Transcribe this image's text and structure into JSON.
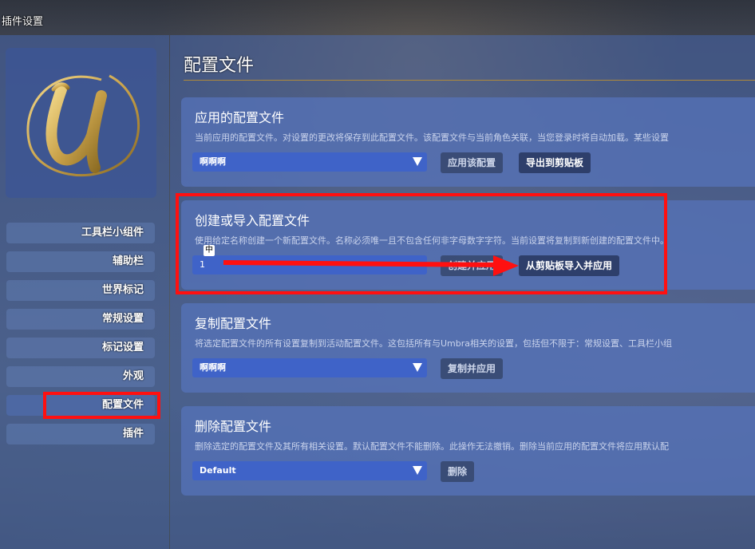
{
  "window": {
    "title": "插件设置"
  },
  "sidebar": {
    "items": [
      {
        "label": "工具栏小组件"
      },
      {
        "label": "辅助栏"
      },
      {
        "label": "世界标记"
      },
      {
        "label": "常规设置"
      },
      {
        "label": "标记设置"
      },
      {
        "label": "外观"
      },
      {
        "label": "配置文件"
      },
      {
        "label": "插件"
      }
    ],
    "active_label": "配置文件"
  },
  "main": {
    "title": "配置文件",
    "applied": {
      "title": "应用的配置文件",
      "desc": "当前应用的配置文件。对设置的更改将保存到此配置文件。该配置文件与当前角色关联，当您登录时将自动加载。某些设置",
      "select_value": "啊啊啊",
      "apply_button": "应用该配置",
      "export_button": "导出到剪贴板"
    },
    "create": {
      "title": "创建或导入配置文件",
      "desc": "使用给定名称创建一个新配置文件。名称必须唯一且不包含任何非字母数字字符。当前设置将复制到新创建的配置文件中。",
      "input_value": "1",
      "ime_indicator": "中",
      "create_button": "创建并应用",
      "import_button": "从剪贴板导入并应用"
    },
    "copy": {
      "title": "复制配置文件",
      "desc": "将选定配置文件的所有设置复制到活动配置文件。这包括所有与Umbra相关的设置，包括但不限于：常规设置、工具栏小组",
      "select_value": "啊啊啊",
      "copy_button": "复制并应用"
    },
    "delete": {
      "title": "删除配置文件",
      "desc": "删除选定的配置文件及其所有相关设置。默认配置文件不能删除。此操作无法撤销。删除当前应用的配置文件将应用默认配",
      "select_value": "Default",
      "delete_button": "删除"
    }
  },
  "icons": {
    "logo": "umbra-u-logo",
    "dropdown": "chevron-down-icon",
    "annotation_arrow": "red-arrow"
  },
  "colors": {
    "highlight": "#ff1010",
    "accent_gold": "#c9a24a",
    "select_bg": "#3f63c8"
  }
}
